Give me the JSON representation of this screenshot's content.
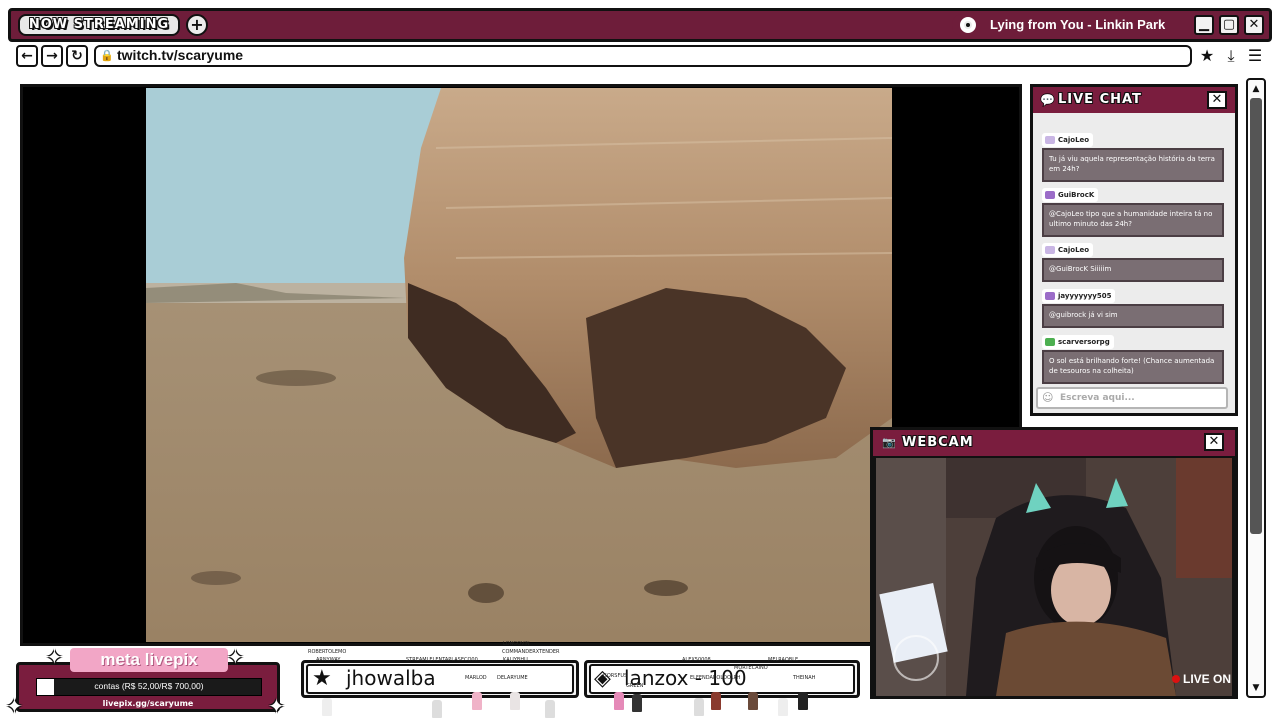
{
  "tab": {
    "label": "NOW STREAMING",
    "add_label": "+"
  },
  "music": {
    "title": "Lying from You - Linkin Park"
  },
  "window": {
    "minimize": "▁",
    "maximize": "▢",
    "close": "✕"
  },
  "nav": {
    "back": "←",
    "forward": "→",
    "reload": "↻",
    "url": "twitch.tv/scaryume"
  },
  "toolbar": {
    "favorite": "★",
    "download": "⤓",
    "menu": "☰"
  },
  "chat": {
    "title": "LIVE CHAT",
    "close": "✕",
    "input_placeholder": "Escreva aqui...",
    "messages": [
      {
        "user": "CajoLeo",
        "text": "Tu já viu aquela representação história da terra em 24h?",
        "badge_color": "#c9b6e4"
      },
      {
        "user": "GuiBrocK",
        "text": "@CajoLeo tipo que a humanidade inteira tá no ultimo minuto das 24h?",
        "badge_color": "#9b6cc8"
      },
      {
        "user": "CajoLeo",
        "text": "@GuiBrocK Siiiiim",
        "badge_color": "#c9b6e4"
      },
      {
        "user": "jayyyyyyy505",
        "text": "@guibrock já vi sim",
        "badge_color": "#9b6cc8"
      },
      {
        "user": "scarversorpg",
        "text": "O sol está brilhando forte! (Chance aumentada de tesouros na colheita)",
        "badge_color": "#4caf50"
      }
    ]
  },
  "webcam": {
    "title": "WEBCAM",
    "close": "✕",
    "live_label": "LIVE ON"
  },
  "goal": {
    "title": "meta livepix",
    "progress_text": "contas (R$ 52,00/R$ 700,00)",
    "progress": 0.074,
    "link": "livepix.gg/scaryume"
  },
  "follows": [
    {
      "name": "jhowalba"
    },
    {
      "name": "lanzox - 100"
    }
  ],
  "community_labels": [
    "ROBERTOLEMO",
    "LONGOVIN",
    "ARNYWAY",
    "STREAMLELENTAPLASECO00",
    "COMMANDERXTENDER",
    "KALIYBHU",
    "MARLOD",
    "DELARYUME",
    "ALEX50008",
    "MORTECAINO",
    "MELRAOBLE",
    "GORSFUS",
    "ELFENDAROLDOLPH",
    "GREEN",
    "THEINAH"
  ],
  "colors": {
    "accent": "#7a1d3e",
    "pink": "#f2a6c6"
  }
}
